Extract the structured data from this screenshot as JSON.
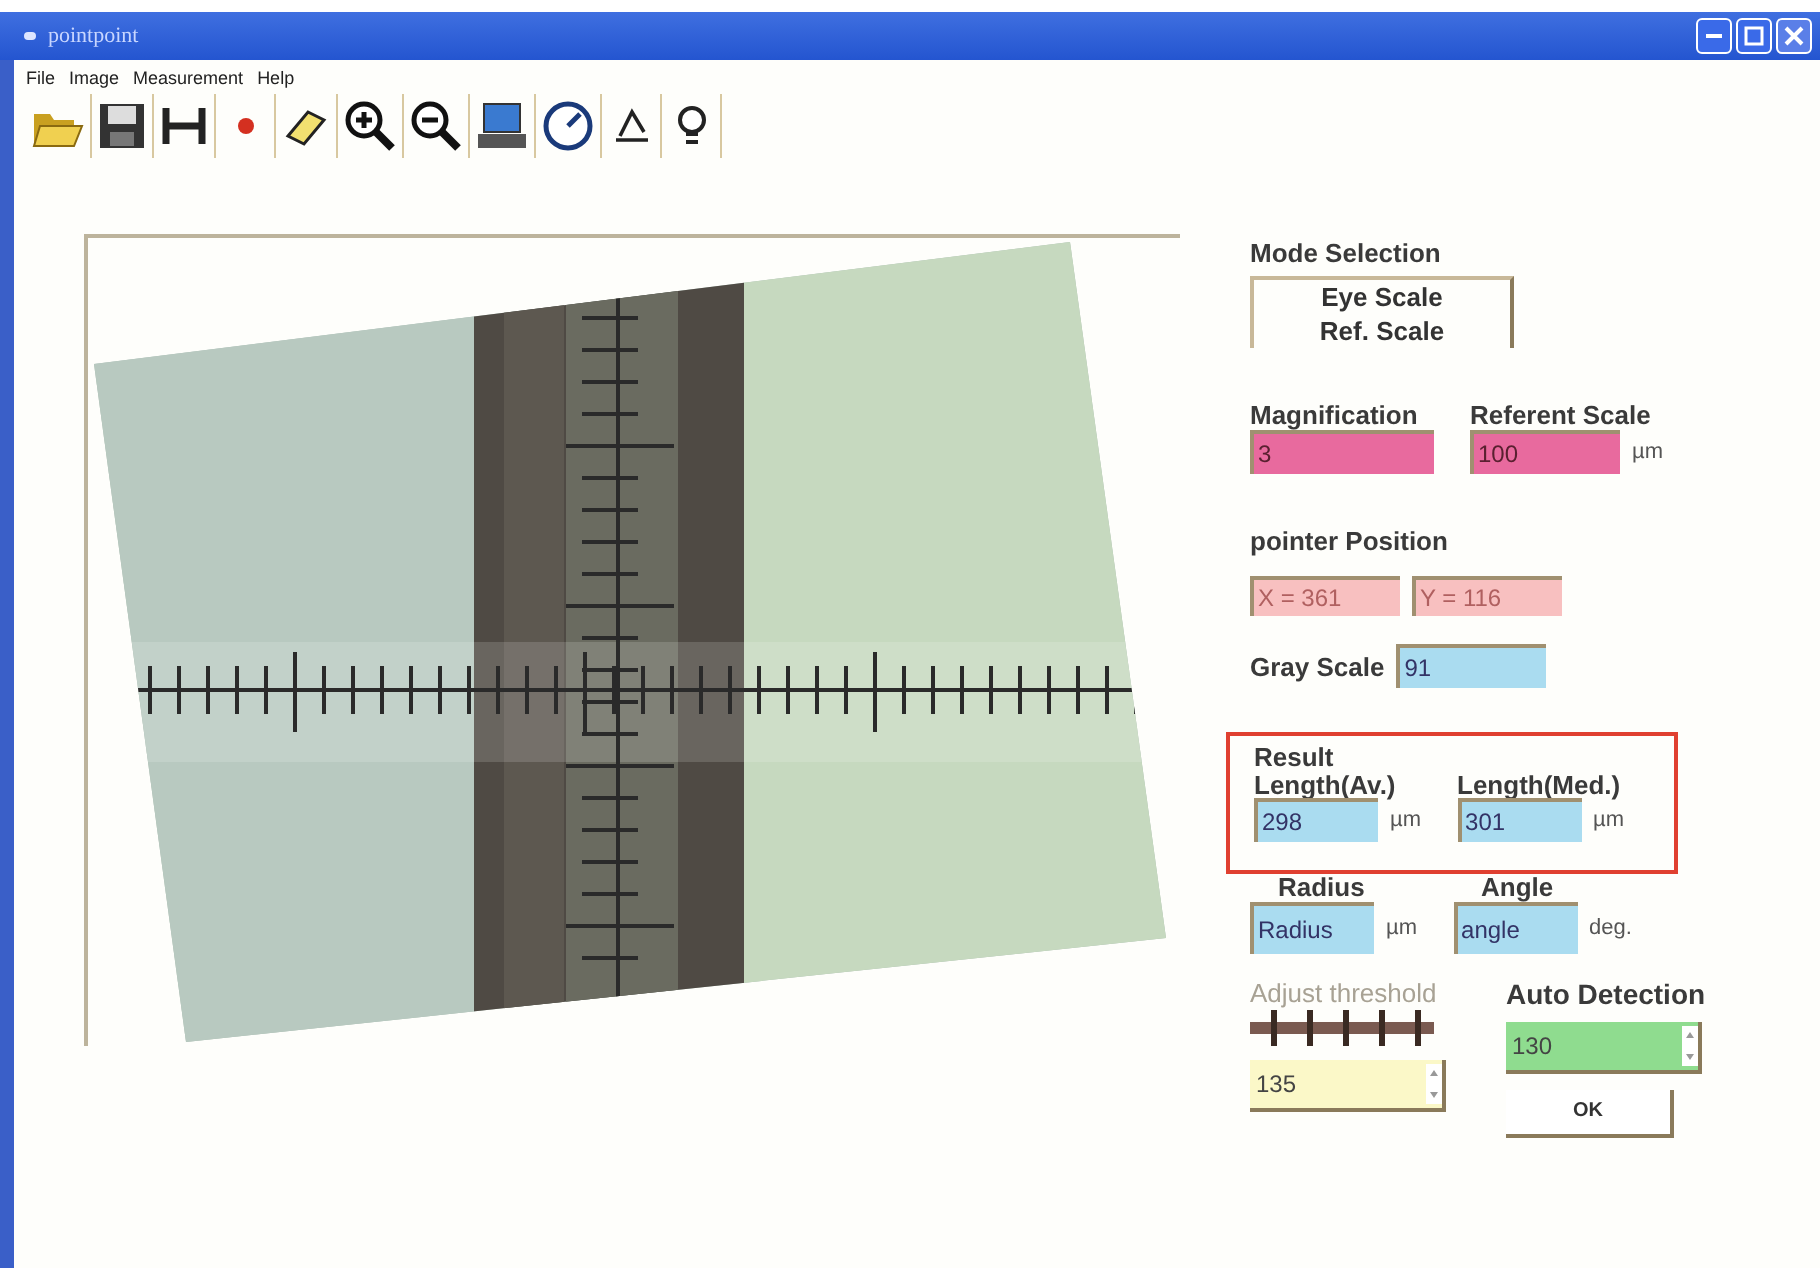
{
  "window": {
    "title": "pointpoint"
  },
  "menu": [
    {
      "label": "File"
    },
    {
      "label": "Image"
    },
    {
      "label": "Measurement"
    },
    {
      "label": "Help"
    }
  ],
  "mode_selection": {
    "label": "Mode Selection",
    "options": [
      "Eye Scale",
      "Ref. Scale"
    ]
  },
  "magnification": {
    "label": "Magnification",
    "value": "3"
  },
  "referent_scale": {
    "label": "Referent Scale",
    "value": "100",
    "unit": "µm"
  },
  "pointer_position": {
    "label": "pointer Position",
    "x": "X = 361",
    "y": "Y = 116"
  },
  "gray_scale": {
    "label": "Gray Scale",
    "value": "91"
  },
  "result": {
    "label": "Result",
    "length_av": {
      "label": "Length(Av.)",
      "value": "298",
      "unit": "µm"
    },
    "length_med": {
      "label": "Length(Med.)",
      "value": "301",
      "unit": "µm"
    }
  },
  "radius": {
    "label": "Radius",
    "value": "Radius",
    "unit": "µm"
  },
  "angle": {
    "label": "Angle",
    "value": "angle",
    "unit": "deg."
  },
  "threshold": {
    "label": "Adjust threshold",
    "disabled": true,
    "value": "135"
  },
  "auto_detection": {
    "label": "Auto Detection",
    "value": "130",
    "button": "OK"
  }
}
